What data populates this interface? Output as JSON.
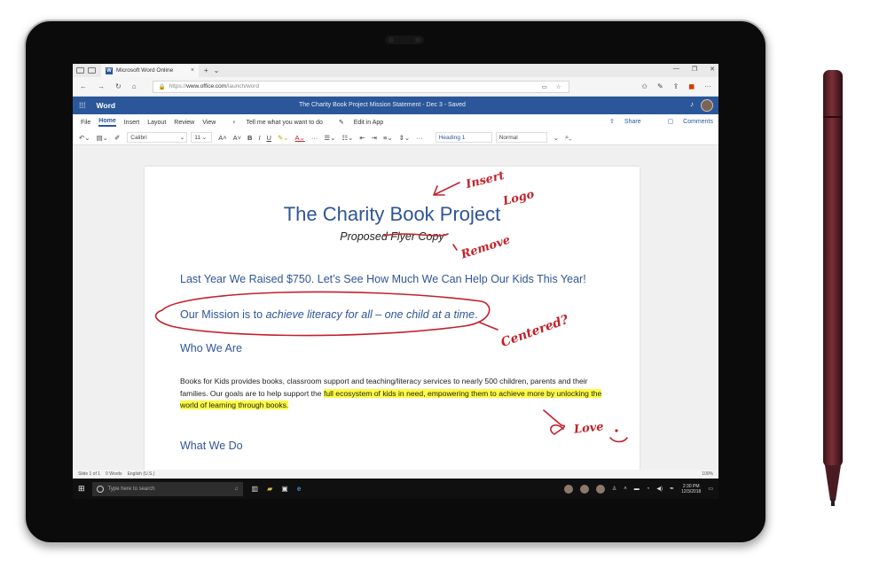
{
  "browser": {
    "tab_title": "Microsoft Word Online",
    "tab_close": "×",
    "new_tab": "+",
    "url_prefix": "https://",
    "url_domain": "www.office.com",
    "url_path": "/launch/word"
  },
  "word": {
    "app_name": "Word",
    "doc_title": "The Charity Book Project Mission Statement - Dec 3 - Saved",
    "menu": [
      "File",
      "Home",
      "Insert",
      "Layout",
      "Review",
      "View"
    ],
    "tell_me": "Tell me what you want to do",
    "edit_in_app": "Edit in App",
    "share": "Share",
    "comments": "Comments",
    "font_name": "Calibri",
    "font_size": "11",
    "style_heading": "Heading 1",
    "style_normal": "Normal"
  },
  "document": {
    "title": "The Charity Book Project",
    "subtitle": "Proposed Flyer Copy",
    "heading_raised": "Last Year We Raised $750. Let’s See How Much We Can Help Our Kids This Year!",
    "mission_prefix": "Our Mission is to ",
    "mission_italic": "achieve literacy for all – one child at a time",
    "mission_suffix": ".",
    "heading_who": "Who We Are",
    "para_plain": "Books for Kids provides books, classroom support and teaching/literacy services to nearly 500 children, parents and their families. Our goals are to help support the ",
    "para_highlight": "full ecosystem of kids in need, empowering them to achieve more by unlocking the world of learning through books.",
    "heading_what": "What We Do"
  },
  "ink": {
    "insert_logo_1": "Insert",
    "insert_logo_2": "Logo",
    "remove": "Remove",
    "centered": "Centered?",
    "love": "Love",
    "ink_color": "#c4202a"
  },
  "status": {
    "slide": "Slide 1 of 1",
    "words": "0 Words",
    "language": "English (U.S.)",
    "zoom": "100%"
  },
  "taskbar": {
    "search_placeholder": "Type here to search",
    "time": "2:30 PM",
    "date": "12/3/2018"
  }
}
